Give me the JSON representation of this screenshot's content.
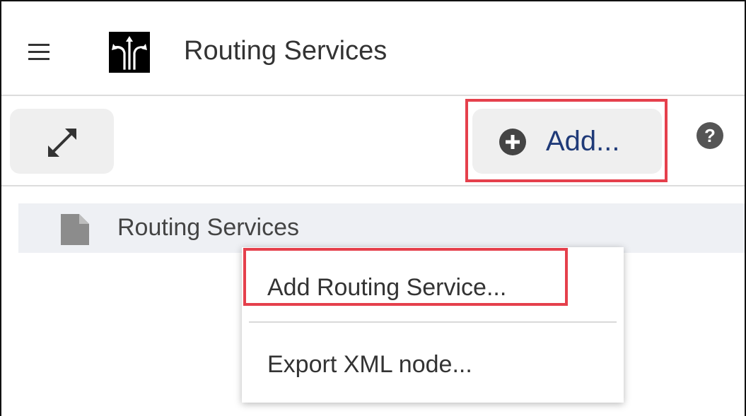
{
  "header": {
    "menu_icon": "hamburger-menu-icon",
    "logo_icon": "routing-logo-icon",
    "title": "Routing Services"
  },
  "toolbar": {
    "expand_icon": "expand-arrows-icon",
    "add_icon": "plus-circle-icon",
    "add_label": "Add...",
    "help_icon": "question-circle-icon",
    "accent_color": "#1f3a78",
    "highlight_color": "#e5404c"
  },
  "tree": {
    "items": [
      {
        "icon": "file-icon",
        "label": "Routing Services"
      }
    ]
  },
  "context_menu": {
    "items": [
      {
        "label": "Add Routing Service..."
      },
      {
        "label": "Export XML node..."
      }
    ]
  }
}
